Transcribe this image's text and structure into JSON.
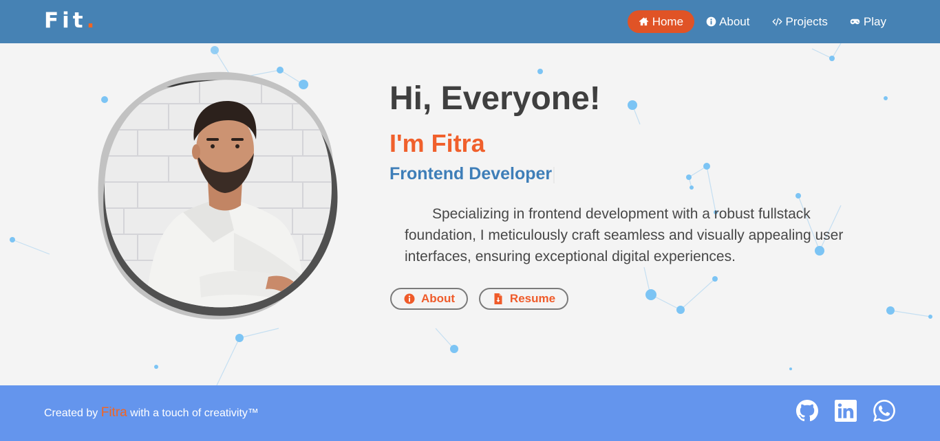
{
  "brand": {
    "text": "Fit",
    "dot": "."
  },
  "nav": {
    "items": [
      {
        "label": "Home",
        "icon": "home-icon",
        "active": true
      },
      {
        "label": "About",
        "icon": "info-icon",
        "active": false
      },
      {
        "label": "Projects",
        "icon": "code-icon",
        "active": false
      },
      {
        "label": "Play",
        "icon": "gamepad-icon",
        "active": false
      }
    ]
  },
  "hero": {
    "greeting": "Hi, Everyone!",
    "name_line": "I'm Fitra",
    "role": "Frontend Developer",
    "bio": "Specializing in frontend development with a robust fullstack foundation, I meticulously craft seamless and visually appealing user interfaces, ensuring exceptional digital experiences.",
    "buttons": {
      "about": "About",
      "resume": "Resume"
    }
  },
  "footer": {
    "credit_prefix": "Created by",
    "credit_author": "Fitra",
    "credit_suffix": "with a touch of creativity™",
    "socials": [
      "github-icon",
      "linkedin-icon",
      "whatsapp-icon"
    ]
  },
  "colors": {
    "navbar": "#4682b4",
    "accent": "#f26522",
    "active_nav": "#e05326",
    "role": "#3e7eb8",
    "footer": "#6495ed",
    "particle": "#7cc4f4"
  }
}
